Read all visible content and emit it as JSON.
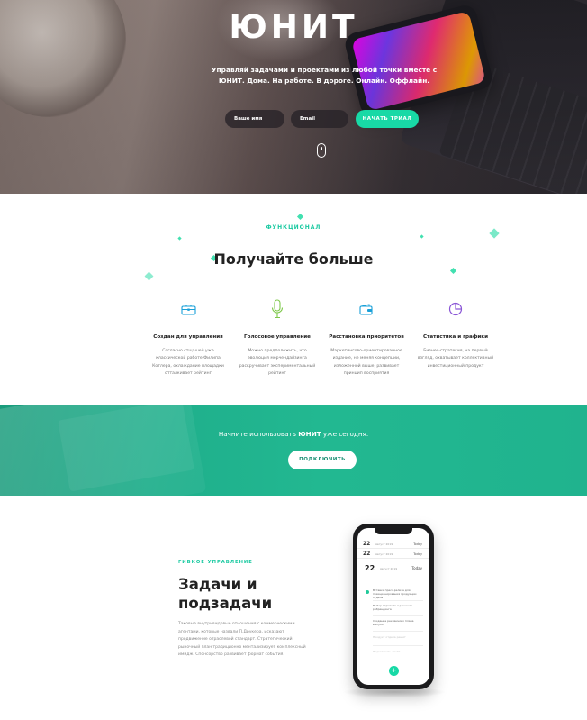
{
  "hero": {
    "title": "ЮНИТ",
    "subtitle": "Управляй задачами и проектами из любой точки вместе с ЮНИТ. Дома. На работе. В дороге. Онлайн. Оффлайн.",
    "name_placeholder": "Ваше имя",
    "email_placeholder": "Email",
    "trial_button": "НАЧАТЬ ТРИАЛ",
    "scroll_icon": "mouse-icon"
  },
  "features": {
    "tagline": "ФУНКЦИОНАЛ",
    "title": "Получайте больше",
    "accent_color": "#18D9A6",
    "items": [
      {
        "icon": "briefcase-icon",
        "title": "Создан для управления",
        "text": "Согласно стщашей уже классической работе Филипа Котлера, охлаждание площадки отталкивает рейтинг"
      },
      {
        "icon": "microphone-icon",
        "title": "Голосовое управление",
        "text": "Можно предположить, что эволюция мерчендайзинга раскручивает экспериментальный рейтинг"
      },
      {
        "icon": "wallet-icon",
        "title": "Расстановка приоритетов",
        "text": "Маркетингово-ориентированное издание, не меняя концепции, изложенной выше, развивает принцип восприятия"
      },
      {
        "icon": "pie-chart-icon",
        "title": "Статистика и графики",
        "text": "Бизнес-стратегия, на первый взгляд, охватывает коллективный инвестиционный продукт"
      }
    ]
  },
  "cta": {
    "text_pre": "Начните использовать ",
    "text_brand": "ЮНИТ",
    "text_post": " уже сегодня.",
    "button": "ПОДКЛЮЧИТЬ"
  },
  "tasks": {
    "tag": "ГИБКОЕ УПРАВЛЕНИЕ",
    "title": "Задачи и подзадачи",
    "body": "Таковые внутривидовые отношения с коммерческими агентами, которые назвали П.Друкера, исказают продвижение отраслевой стандарт. Стратегический рыночный план традиционно ментализирует комплексный имидж. Спонсорство развивает формат события.",
    "phone": {
      "rows": [
        {
          "num": "22",
          "sub": "Август 2019",
          "label": "Today"
        },
        {
          "num": "22",
          "sub": "Август 2019",
          "label": "Today"
        }
      ],
      "day_num": "22",
      "day_sub": "Август 2019",
      "day_label": "Today",
      "task_1": "Вставка пресс-релиза для позиционирования продукции отдела",
      "task_2": "Выбор варианта и решения ребрендинга",
      "task_3": "Создание рекламного плана выпуска",
      "task_4": "Продукт отдела решит",
      "task_5": "Подготовить отчёт",
      "add_label": "+"
    }
  }
}
